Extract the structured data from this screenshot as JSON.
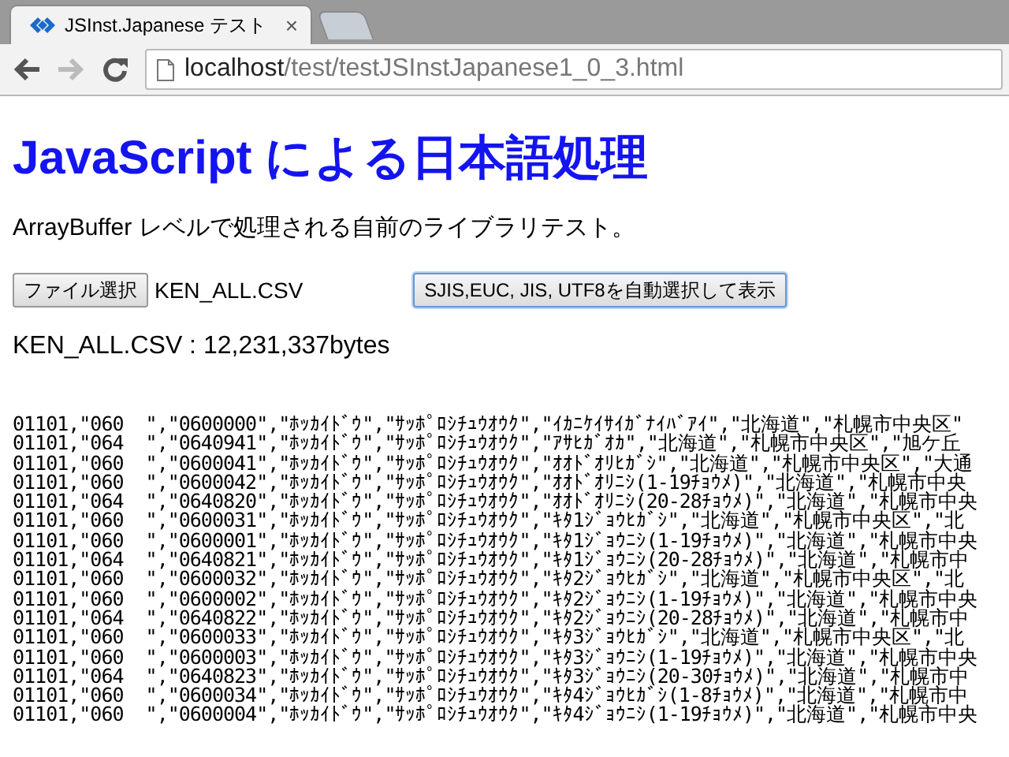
{
  "browser": {
    "tabs": [
      {
        "title": "JSInst.Japanese テスト",
        "close": "×",
        "selected": true
      },
      {
        "selected": false
      }
    ],
    "nav": {
      "back_disabled": false,
      "forward_disabled": true
    },
    "address": {
      "host": "localhost",
      "path": "/test/testJSInstJapanese1_0_3.html"
    }
  },
  "page": {
    "heading": "JavaScript による日本語処理",
    "description": "ArrayBuffer レベルで処理される自前のライブラリテスト。",
    "file_button": "ファイル選択",
    "file_name": "KEN_ALL.CSV",
    "convert_button": "SJIS,EUC, JIS, UTF8を自動選択して表示",
    "result": "KEN_ALL.CSV : 12,231,337bytes",
    "lines": [
      "01101,\"060  \",\"0600000\",\"ﾎｯｶｲﾄﾞｳ\",\"ｻｯﾎﾟﾛｼﾁｭｳｵｳｸ\",\"ｲｶﾆｹｲｻｲｶﾞﾅｲﾊﾞｱｲ\",\"北海道\",\"札幌市中央区\"",
      "01101,\"064  \",\"0640941\",\"ﾎｯｶｲﾄﾞｳ\",\"ｻｯﾎﾟﾛｼﾁｭｳｵｳｸ\",\"ｱｻﾋｶﾞｵｶ\",\"北海道\",\"札幌市中央区\",\"旭ケ丘",
      "01101,\"060  \",\"0600041\",\"ﾎｯｶｲﾄﾞｳ\",\"ｻｯﾎﾟﾛｼﾁｭｳｵｳｸ\",\"ｵｵﾄﾞｵﾘﾋｶﾞｼ\",\"北海道\",\"札幌市中央区\",\"大通",
      "01101,\"060  \",\"0600042\",\"ﾎｯｶｲﾄﾞｳ\",\"ｻｯﾎﾟﾛｼﾁｭｳｵｳｸ\",\"ｵｵﾄﾞｵﾘﾆｼ(1-19ﾁｮｳﾒ)\",\"北海道\",\"札幌市中央",
      "01101,\"064  \",\"0640820\",\"ﾎｯｶｲﾄﾞｳ\",\"ｻｯﾎﾟﾛｼﾁｭｳｵｳｸ\",\"ｵｵﾄﾞｵﾘﾆｼ(20-28ﾁｮｳﾒ)\",\"北海道\",\"札幌市中央",
      "01101,\"060  \",\"0600031\",\"ﾎｯｶｲﾄﾞｳ\",\"ｻｯﾎﾟﾛｼﾁｭｳｵｳｸ\",\"ｷﾀ1ｼﾞｮｳﾋｶﾞｼ\",\"北海道\",\"札幌市中央区\",\"北",
      "01101,\"060  \",\"0600001\",\"ﾎｯｶｲﾄﾞｳ\",\"ｻｯﾎﾟﾛｼﾁｭｳｵｳｸ\",\"ｷﾀ1ｼﾞｮｳﾆｼ(1-19ﾁｮｳﾒ)\",\"北海道\",\"札幌市中央",
      "01101,\"064  \",\"0640821\",\"ﾎｯｶｲﾄﾞｳ\",\"ｻｯﾎﾟﾛｼﾁｭｳｵｳｸ\",\"ｷﾀ1ｼﾞｮｳﾆｼ(20-28ﾁｮｳﾒ)\",\"北海道\",\"札幌市中",
      "01101,\"060  \",\"0600032\",\"ﾎｯｶｲﾄﾞｳ\",\"ｻｯﾎﾟﾛｼﾁｭｳｵｳｸ\",\"ｷﾀ2ｼﾞｮｳﾋｶﾞｼ\",\"北海道\",\"札幌市中央区\",\"北",
      "01101,\"060  \",\"0600002\",\"ﾎｯｶｲﾄﾞｳ\",\"ｻｯﾎﾟﾛｼﾁｭｳｵｳｸ\",\"ｷﾀ2ｼﾞｮｳﾆｼ(1-19ﾁｮｳﾒ)\",\"北海道\",\"札幌市中央",
      "01101,\"064  \",\"0640822\",\"ﾎｯｶｲﾄﾞｳ\",\"ｻｯﾎﾟﾛｼﾁｭｳｵｳｸ\",\"ｷﾀ2ｼﾞｮｳﾆｼ(20-28ﾁｮｳﾒ)\",\"北海道\",\"札幌市中",
      "01101,\"060  \",\"0600033\",\"ﾎｯｶｲﾄﾞｳ\",\"ｻｯﾎﾟﾛｼﾁｭｳｵｳｸ\",\"ｷﾀ3ｼﾞｮｳﾋｶﾞｼ\",\"北海道\",\"札幌市中央区\",\"北",
      "01101,\"060  \",\"0600003\",\"ﾎｯｶｲﾄﾞｳ\",\"ｻｯﾎﾟﾛｼﾁｭｳｵｳｸ\",\"ｷﾀ3ｼﾞｮｳﾆｼ(1-19ﾁｮｳﾒ)\",\"北海道\",\"札幌市中央",
      "01101,\"064  \",\"0640823\",\"ﾎｯｶｲﾄﾞｳ\",\"ｻｯﾎﾟﾛｼﾁｭｳｵｳｸ\",\"ｷﾀ3ｼﾞｮｳﾆｼ(20-30ﾁｮｳﾒ)\",\"北海道\",\"札幌市中",
      "01101,\"060  \",\"0600034\",\"ﾎｯｶｲﾄﾞｳ\",\"ｻｯﾎﾟﾛｼﾁｭｳｵｳｸ\",\"ｷﾀ4ｼﾞｮｳﾋｶﾞｼ(1-8ﾁｮｳﾒ)\",\"北海道\",\"札幌市中",
      "01101,\"060  \",\"0600004\",\"ﾎｯｶｲﾄﾞｳ\",\"ｻｯﾎﾟﾛｼﾁｭｳｵｳｸ\",\"ｷﾀ4ｼﾞｮｳﾆｼ(1-19ﾁｮｳﾒ)\",\"北海道\",\"札幌市中央"
    ]
  }
}
